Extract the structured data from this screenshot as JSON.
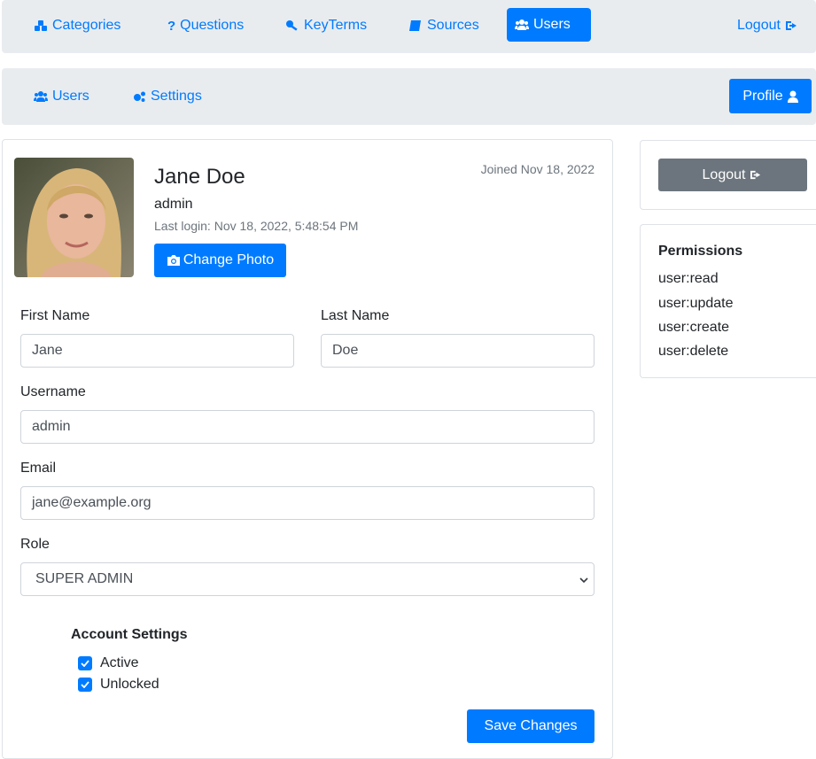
{
  "topnav": {
    "categories": "Categories",
    "questions": "Questions",
    "keyterms": "KeyTerms",
    "sources": "Sources",
    "users": "Users",
    "logout": "Logout"
  },
  "subnav": {
    "users": "Users",
    "settings": "Settings",
    "profile": "Profile"
  },
  "profile": {
    "name": "Jane Doe",
    "username": "admin",
    "last_login": "Last login: Nov 18, 2022, 5:48:54 PM",
    "joined": "Joined Nov 18, 2022",
    "change_photo": "Change Photo"
  },
  "form": {
    "first_name_label": "First Name",
    "first_name_value": "Jane",
    "last_name_label": "Last Name",
    "last_name_value": "Doe",
    "username_label": "Username",
    "username_value": "admin",
    "email_label": "Email",
    "email_value": "jane@example.org",
    "role_label": "Role",
    "role_value": "SUPER ADMIN",
    "account_settings_heading": "Account Settings",
    "active_label": "Active",
    "unlocked_label": "Unlocked",
    "save_label": "Save Changes"
  },
  "sidebar": {
    "logout": "Logout",
    "permissions_heading": "Permissions",
    "permissions": [
      "user:read",
      "user:update",
      "user:create",
      "user:delete"
    ]
  },
  "colors": {
    "accent": "#007bff",
    "navbar_bg": "#e9ecef",
    "secondary_button": "#6c757d"
  }
}
